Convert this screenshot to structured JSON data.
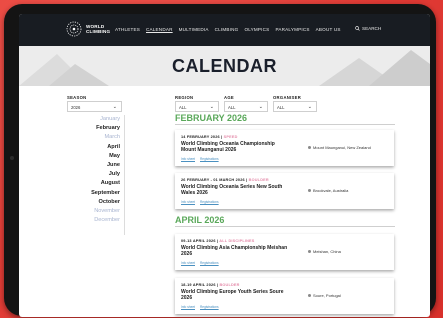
{
  "nav": {
    "logo_line1": "WORLD",
    "logo_line2": "CLIMBING",
    "links": [
      "ATHLETES",
      "CALENDAR",
      "MULTIMEDIA",
      "CLIMBING",
      "OLYMPICS",
      "PARALYMPICS",
      "ABOUT US"
    ],
    "active_link": "CALENDAR",
    "search_label": "SEARCH"
  },
  "page": {
    "title": "CALENDAR"
  },
  "filters": {
    "season": {
      "label": "SEASON",
      "value": "2026"
    },
    "region": {
      "label": "REGION",
      "value": "ALL"
    },
    "age": {
      "label": "AGE",
      "value": "ALL"
    },
    "organiser": {
      "label": "ORGANISER",
      "value": "ALL"
    }
  },
  "months": [
    {
      "name": "January",
      "active": false
    },
    {
      "name": "February",
      "active": true
    },
    {
      "name": "March",
      "active": false
    },
    {
      "name": "April",
      "active": true
    },
    {
      "name": "May",
      "active": true
    },
    {
      "name": "June",
      "active": true
    },
    {
      "name": "July",
      "active": true
    },
    {
      "name": "August",
      "active": true
    },
    {
      "name": "September",
      "active": true
    },
    {
      "name": "October",
      "active": true
    },
    {
      "name": "November",
      "active": false
    },
    {
      "name": "December",
      "active": false
    }
  ],
  "sections": {
    "feb": "FEBRUARY 2026",
    "apr": "APRIL 2026"
  },
  "events": [
    {
      "date": "14 FEBRUARY 2026",
      "discipline": "SPEED",
      "title": "World Climbing Oceania Championship Mount Maunganui 2026",
      "location": "Mount Maunganui, New Zealand",
      "link1": "Info sheet",
      "link2": "Registrations"
    },
    {
      "date": "26 FEBRUARY - 01 MARCH 2026",
      "discipline": "BOULDER",
      "title": "World Climbing Oceania Series New South Wales 2026",
      "location": "Brookvale, Australia",
      "link1": "Info sheet",
      "link2": "Registrations"
    },
    {
      "date": "09-13 APRIL 2026",
      "discipline": "ALL DISCIPLINES",
      "title": "World Climbing Asia Championship Meishan 2026",
      "location": "Meishan, China",
      "link1": "Info sheet",
      "link2": "Registrations"
    },
    {
      "date": "18-19 APRIL 2026",
      "discipline": "BOULDER",
      "title": "World Climbing Europe Youth Series Soure 2026",
      "location": "Soure, Portugal",
      "link1": "Info sheet",
      "link2": "Registrations"
    }
  ],
  "colors": {
    "background": "#e23a34",
    "nav_bg": "#181c22",
    "section_green": "#5aa85a",
    "discipline_pink": "#e48aa9",
    "link_blue": "#4a90c0"
  }
}
